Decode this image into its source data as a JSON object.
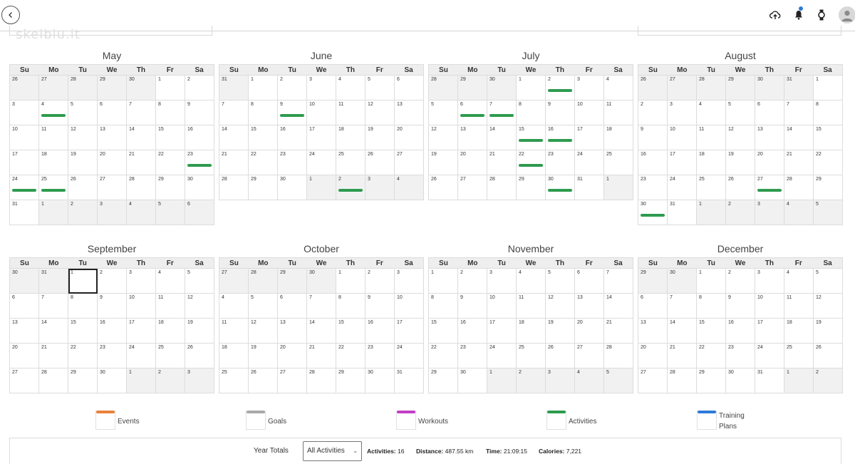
{
  "weekdays": [
    "Su",
    "Mo",
    "Tu",
    "We",
    "Th",
    "Fr",
    "Sa"
  ],
  "watermark": "skelbiu.lt",
  "months": [
    {
      "name": "May",
      "start": 26,
      "prev_len": 30,
      "len": 31,
      "weeks": 6,
      "bars": [
        4,
        23,
        24,
        25
      ]
    },
    {
      "name": "June",
      "start": 31,
      "prev_len": 31,
      "len": 30,
      "weeks": 5,
      "bars": [
        9,
        32
      ]
    },
    {
      "name": "July",
      "start": 28,
      "prev_len": 30,
      "len": 31,
      "weeks": 5,
      "bars": [
        2,
        6,
        7,
        15,
        16,
        22,
        30
      ]
    },
    {
      "name": "August",
      "start": 26,
      "prev_len": 31,
      "len": 31,
      "weeks": 6,
      "bars": [
        30,
        27
      ]
    },
    {
      "name": "September",
      "start": 30,
      "prev_len": 31,
      "len": 30,
      "weeks": 5,
      "bars": [],
      "today": 1
    },
    {
      "name": "October",
      "start": 27,
      "prev_len": 30,
      "len": 31,
      "weeks": 5,
      "bars": []
    },
    {
      "name": "November",
      "start": 1,
      "prev_len": 31,
      "len": 30,
      "weeks": 5,
      "bars": []
    },
    {
      "name": "December",
      "start": 29,
      "prev_len": 30,
      "len": 31,
      "weeks": 5,
      "bars": []
    }
  ],
  "legend": [
    {
      "label": "Events",
      "color": "#e8823a"
    },
    {
      "label": "Goals",
      "color": "#a9a9a9"
    },
    {
      "label": "Workouts",
      "color": "#c13fc4"
    },
    {
      "label": "Activities",
      "color": "#2e9b4f"
    },
    {
      "label": "Training Plans",
      "color": "#2f7ad9"
    }
  ],
  "totals": {
    "title": "Year Totals",
    "filter": "All Activities",
    "activities_label": "Activities:",
    "activities_value": "16",
    "distance_label": "Distance:",
    "distance_value": "487.55 km",
    "time_label": "Time:",
    "time_value": "21:09:15",
    "calories_label": "Calories:",
    "calories_value": "7,221"
  },
  "colors": {
    "activity": "#2e9b4f",
    "outside": "#f1f1f1",
    "header": "#eeeeee"
  }
}
